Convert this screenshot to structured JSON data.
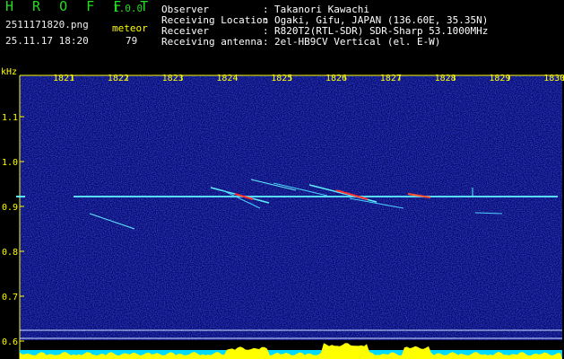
{
  "header": {
    "app_title": "H R O F F T",
    "version": "1.0.0",
    "filename": "2511171820.png",
    "datetime": "25.11.17 18:20",
    "meteor_label": "meteor",
    "meteor_count": "79",
    "info": [
      {
        "label": "Observer",
        "value": "Takanori Kawachi"
      },
      {
        "label": "Receiving Location",
        "value": "Ogaki, Gifu, JAPAN (136.60E, 35.35N)"
      },
      {
        "label": "Receiver",
        "value": "R820T2(RTL-SDR) SDR-Sharp 53.1000MHz"
      },
      {
        "label": "Receiving antenna",
        "value": "2el-HB9CV Vertical (el. E-W)"
      }
    ],
    "separator": ":"
  },
  "axis": {
    "unit_label": "kHz",
    "time_ticks": [
      "1821",
      "1822",
      "1823",
      "1824",
      "1825",
      "1826",
      "1827",
      "1828",
      "1829",
      "1830"
    ],
    "freq_ticks": [
      "1.1",
      "1.0",
      "0.9",
      "0.8",
      "0.7",
      "0.6"
    ]
  },
  "colors": {
    "background": "#000000",
    "spectrogram_bg": "#050a6e",
    "header_green": "#22dd22",
    "axis_yellow": "#ffff00",
    "trace_cyan": "#5ff0ff"
  }
}
